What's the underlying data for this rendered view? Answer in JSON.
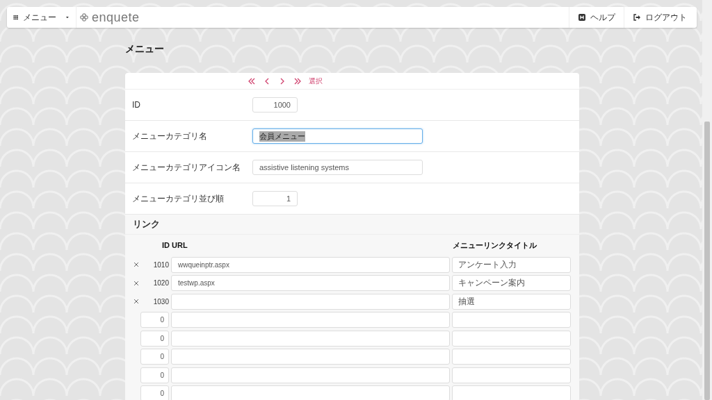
{
  "navbar": {
    "menu_label": "メニュー",
    "brand": "enquete",
    "help": "ヘルプ",
    "logout": "ログアウト"
  },
  "page_title": "メニュー",
  "pager": {
    "select": "選択"
  },
  "fields": [
    {
      "label": "ID",
      "value": "1000",
      "kind": "short",
      "focused": false
    },
    {
      "label": "メニューカテゴリ名",
      "value": "会員メニュー",
      "kind": "long",
      "focused": true
    },
    {
      "label": "メニューカテゴリアイコン名",
      "value": "assistive listening systems",
      "kind": "long",
      "focused": false
    },
    {
      "label": "メニューカテゴリ並び順",
      "value": "1",
      "kind": "short",
      "focused": false
    }
  ],
  "links": {
    "title": "リンク",
    "columns": [
      "ID URL",
      "メニューリンクタイトル"
    ],
    "rows": [
      {
        "kind": "existing",
        "id": "1010",
        "url": "wwqueinptr.aspx",
        "title": "アンケート入力"
      },
      {
        "kind": "existing",
        "id": "1020",
        "url": "testwp.aspx",
        "title": "キャンペーン案内"
      },
      {
        "kind": "existing",
        "id": "1030",
        "title": "抽選"
      },
      {
        "kind": "new",
        "id": "0"
      },
      {
        "kind": "new",
        "id": "0"
      },
      {
        "kind": "new",
        "id": "0"
      },
      {
        "kind": "new",
        "id": "0"
      },
      {
        "kind": "new",
        "id": "0"
      }
    ]
  }
}
